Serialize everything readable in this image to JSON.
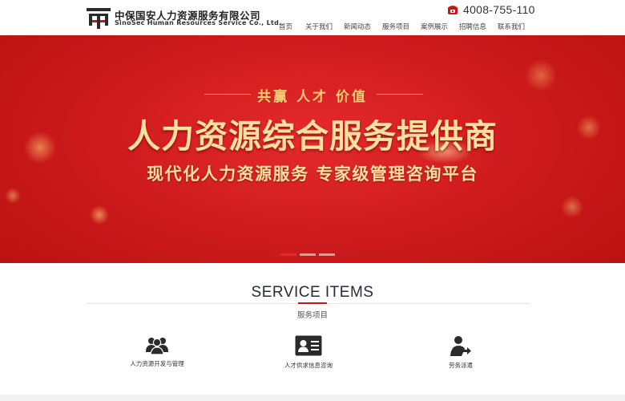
{
  "header": {
    "company_cn": "中保国安人力资源服务有限公司",
    "company_en": "SinoSec Human Resources Service Co., Ltd.",
    "phone": "4008-755-110",
    "phone_icon": "telephone-icon",
    "nav": [
      "首页",
      "关于我们",
      "新闻动态",
      "服务项目",
      "案例展示",
      "招聘信息",
      "联系我们"
    ]
  },
  "banner": {
    "subtitle": "共赢  人才  价值",
    "title": "人力资源综合服务提供商",
    "tagline": "现代化人力资源服务   专家级管理咨询平台",
    "slides_total": 3,
    "active_slide": 1
  },
  "services": {
    "title": "SERVICE ITEMS",
    "subtitle": "服务项目",
    "items": [
      {
        "label": "人力资源开发与管理",
        "icon": "team-icon"
      },
      {
        "label": "人才供求信息咨询",
        "icon": "id-card-icon"
      },
      {
        "label": "劳务派遣",
        "icon": "dispatch-person-icon"
      }
    ]
  },
  "colors": {
    "brand_red": "#c8161d",
    "banner_gold": "#fbe0a0"
  }
}
